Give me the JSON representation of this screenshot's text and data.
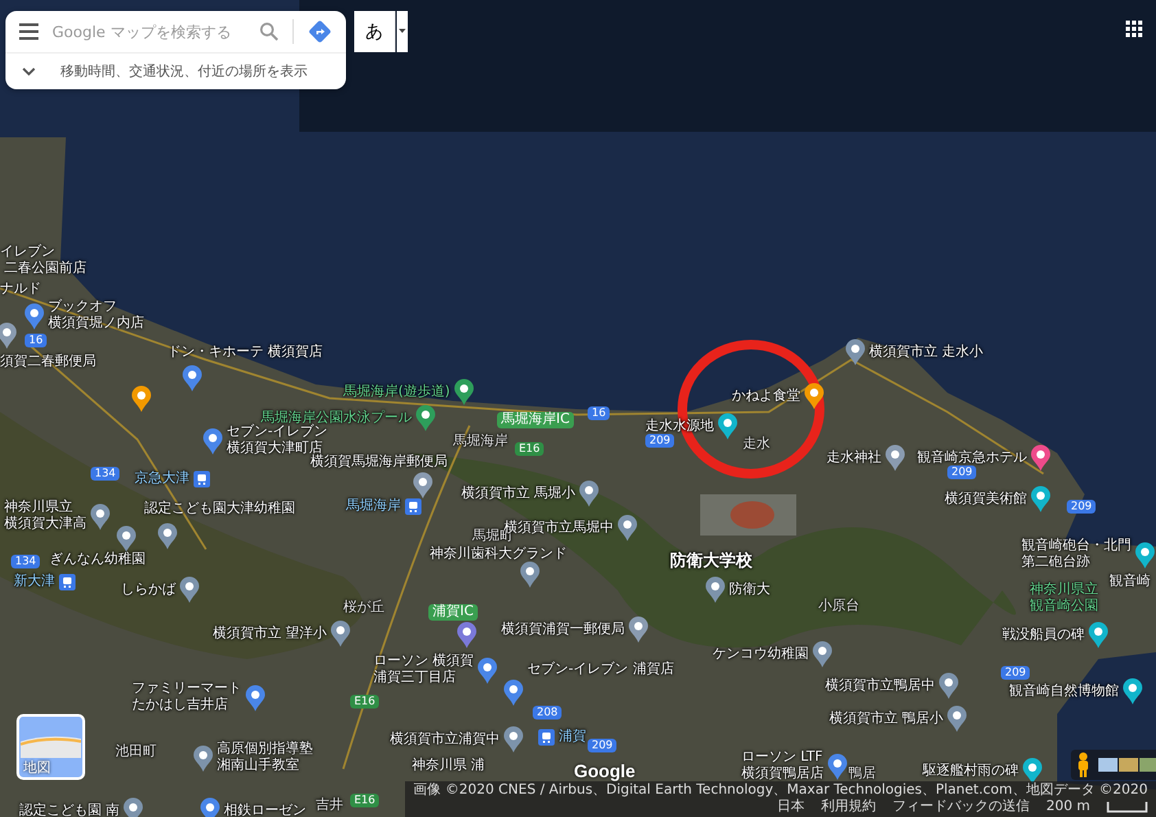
{
  "search_box": {
    "placeholder": "Google マップを検索する",
    "suggestion": "移動時間、交通状況、付近の場所を表示"
  },
  "input_tool": {
    "label": "あ"
  },
  "map": {
    "labels": [
      {
        "lines": [
          "イレブン"
        ],
        "kind": "place"
      },
      {
        "lines": [
          "二春公園前店"
        ],
        "kind": "place"
      },
      {
        "lines": [
          "ナルド"
        ],
        "kind": "place"
      },
      {
        "lines": [
          "ブックオフ",
          "横須賀堀ノ内店"
        ],
        "kind": "place",
        "pin": {
          "kind": "shop"
        }
      },
      {
        "lines": [
          "須賀二春郵便局"
        ],
        "kind": "place",
        "pin": {
          "kind": "post"
        }
      },
      {
        "lines": [
          "ドン・キホーテ 横須賀店"
        ],
        "kind": "place",
        "pin": {
          "kind": "shop"
        }
      },
      {
        "lines": [
          "馬堀海岸(遊歩道)"
        ],
        "kind": "park",
        "pin": {
          "kind": "park"
        }
      },
      {
        "lines": [
          "横須賀市立 走水小"
        ],
        "kind": "place",
        "pin": {
          "kind": "school"
        }
      },
      {
        "lines": [
          "かねよ食堂"
        ],
        "kind": "place",
        "pin": {
          "kind": "restaurant"
        }
      },
      {
        "lines": [
          "セブン-イレブン",
          "横須賀大津町店"
        ],
        "kind": "place",
        "pin": {
          "kind": "store"
        }
      },
      {
        "lines": [
          "馬堀海岸公園水泳プール"
        ],
        "kind": "park",
        "pin": {
          "kind": "park"
        }
      },
      {
        "lines": [
          "走水水源地"
        ],
        "kind": "place",
        "pin": {
          "kind": "tourist"
        }
      },
      {
        "lines": [
          "馬堀海岸"
        ],
        "kind": "area"
      },
      {
        "lines": [
          "走水"
        ],
        "kind": "area"
      },
      {
        "lines": [
          "横須賀馬堀海岸郵便局"
        ],
        "kind": "place",
        "pin": {
          "kind": "post"
        }
      },
      {
        "lines": [
          "走水神社"
        ],
        "kind": "place",
        "pin": {
          "kind": "shrine"
        }
      },
      {
        "lines": [
          "観音崎京急ホテル"
        ],
        "kind": "place",
        "pin": {
          "kind": "hotel"
        }
      },
      {
        "lines": [
          "京急大津"
        ],
        "kind": "station",
        "pin": {
          "kind": "station"
        }
      },
      {
        "lines": [
          "横須賀市立 馬堀小"
        ],
        "kind": "place",
        "pin": {
          "kind": "school"
        }
      },
      {
        "lines": [
          "横須賀美術館"
        ],
        "kind": "place",
        "pin": {
          "kind": "museum"
        }
      },
      {
        "lines": [
          "神奈川県立",
          "横須賀大津高"
        ],
        "kind": "place",
        "pin": {
          "kind": "school"
        }
      },
      {
        "lines": [
          "認定こども園大津幼稚園"
        ],
        "kind": "place"
      },
      {
        "lines": [
          "馬堀海岸"
        ],
        "kind": "station",
        "pin": {
          "kind": "station"
        }
      },
      {
        "lines": [
          "馬堀町"
        ],
        "kind": "area"
      },
      {
        "lines": [
          "横須賀市立馬堀中"
        ],
        "kind": "place",
        "pin": {
          "kind": "school"
        }
      },
      {
        "lines": [
          "ぎんなん幼稚園"
        ],
        "kind": "place"
      },
      {
        "lines": [
          "神奈川歯科大グランド"
        ],
        "kind": "place",
        "pin": {
          "kind": "school"
        }
      },
      {
        "lines": [
          "防衛大学校"
        ],
        "kind": "landmark"
      },
      {
        "lines": [
          "観音崎砲台・北門",
          "第二砲台跡"
        ],
        "kind": "place",
        "pin": {
          "kind": "tourist"
        }
      },
      {
        "lines": [
          "新大津"
        ],
        "kind": "station",
        "pin": {
          "kind": "station"
        }
      },
      {
        "lines": [
          "しらかば"
        ],
        "kind": "place",
        "pin": {
          "kind": "school"
        }
      },
      {
        "lines": [
          "防衛大"
        ],
        "kind": "place",
        "pin": {
          "kind": "school"
        }
      },
      {
        "lines": [
          "桜が丘"
        ],
        "kind": "area"
      },
      {
        "lines": [
          "小原台"
        ],
        "kind": "area"
      },
      {
        "lines": [
          "神奈川県立",
          "観音崎公園"
        ],
        "kind": "park"
      },
      {
        "lines": [
          "観音崎"
        ],
        "kind": "place"
      },
      {
        "lines": [
          "横須賀市立 望洋小"
        ],
        "kind": "place",
        "pin": {
          "kind": "school"
        }
      },
      {
        "lines": [
          "横須賀浦賀一郵便局"
        ],
        "kind": "place",
        "pin": {
          "kind": "post"
        }
      },
      {
        "lines": [
          "戦没船員の碑"
        ],
        "kind": "place",
        "pin": {
          "kind": "tourist"
        }
      },
      {
        "lines": [
          "ファミリーマート",
          "たかはし吉井店"
        ],
        "kind": "place",
        "pin": {
          "kind": "store"
        }
      },
      {
        "lines": [
          "ローソン 横須賀",
          "浦賀三丁目店"
        ],
        "kind": "place",
        "pin": {
          "kind": "store"
        }
      },
      {
        "lines": [
          "セブン-イレブン 浦賀店"
        ],
        "kind": "place",
        "pin": {
          "kind": "store"
        }
      },
      {
        "lines": [
          "ケンコウ幼稚園"
        ],
        "kind": "place",
        "pin": {
          "kind": "school"
        }
      },
      {
        "lines": [
          "横須賀市立鴨居中"
        ],
        "kind": "place",
        "pin": {
          "kind": "school"
        }
      },
      {
        "lines": [
          "観音崎自然博物館"
        ],
        "kind": "place",
        "pin": {
          "kind": "museum"
        }
      },
      {
        "lines": [
          "横須賀市立 鴨居小"
        ],
        "kind": "place",
        "pin": {
          "kind": "school"
        }
      },
      {
        "lines": [
          "池田町"
        ],
        "kind": "area"
      },
      {
        "lines": [
          "高原個別指導塾",
          "湘南山手教室"
        ],
        "kind": "place",
        "pin": {
          "kind": "school"
        }
      },
      {
        "lines": [
          "横須賀市立浦賀中"
        ],
        "kind": "place",
        "pin": {
          "kind": "school"
        }
      },
      {
        "lines": [
          "浦賀"
        ],
        "kind": "station",
        "pin": {
          "kind": "station"
        }
      },
      {
        "lines": [
          "神奈川県 浦"
        ],
        "kind": "place"
      },
      {
        "lines": [
          "ローソン LTF",
          "横須賀鴨居店"
        ],
        "kind": "place",
        "pin": {
          "kind": "store"
        }
      },
      {
        "lines": [
          "鴨居"
        ],
        "kind": "area"
      },
      {
        "lines": [
          "駆逐艦村雨の碑"
        ],
        "kind": "place",
        "pin": {
          "kind": "tourist"
        }
      },
      {
        "lines": [
          "認定こども園 南"
        ],
        "kind": "place",
        "pin": {
          "kind": "school"
        }
      },
      {
        "lines": [
          "相鉄ローゼン"
        ],
        "kind": "place",
        "pin": {
          "kind": "shop"
        }
      },
      {
        "lines": [
          "吉井"
        ],
        "kind": "area"
      }
    ],
    "pins": [
      {
        "kind": "restaurant"
      },
      {
        "kind": "school"
      },
      {
        "kind": "school"
      },
      {
        "kind": "gas"
      }
    ],
    "shields": [
      {
        "text": "16",
        "kind": "national"
      },
      {
        "text": "134",
        "kind": "national"
      },
      {
        "text": "134",
        "kind": "national"
      },
      {
        "text": "16",
        "kind": "national"
      },
      {
        "text": "E16",
        "kind": "expressway"
      },
      {
        "text": "馬堀海岸IC",
        "kind": "interchange"
      },
      {
        "text": "209",
        "kind": "national"
      },
      {
        "text": "209",
        "kind": "national"
      },
      {
        "text": "209",
        "kind": "national"
      },
      {
        "text": "浦賀IC",
        "kind": "interchange"
      },
      {
        "text": "209",
        "kind": "national"
      },
      {
        "text": "E16",
        "kind": "expressway"
      },
      {
        "text": "208",
        "kind": "national"
      },
      {
        "text": "209",
        "kind": "national"
      },
      {
        "text": "E16",
        "kind": "expressway"
      }
    ]
  },
  "layer_switcher": {
    "label": "地図"
  },
  "logo": "Google",
  "footer": {
    "attribution": "画像 ©2020 CNES / Airbus、Digital Earth Technology、Maxar Technologies、Planet.com、地図データ ©2020",
    "country": "日本",
    "terms": "利用規約",
    "feedback": "フィードバックの送信",
    "scale": "200 m"
  }
}
